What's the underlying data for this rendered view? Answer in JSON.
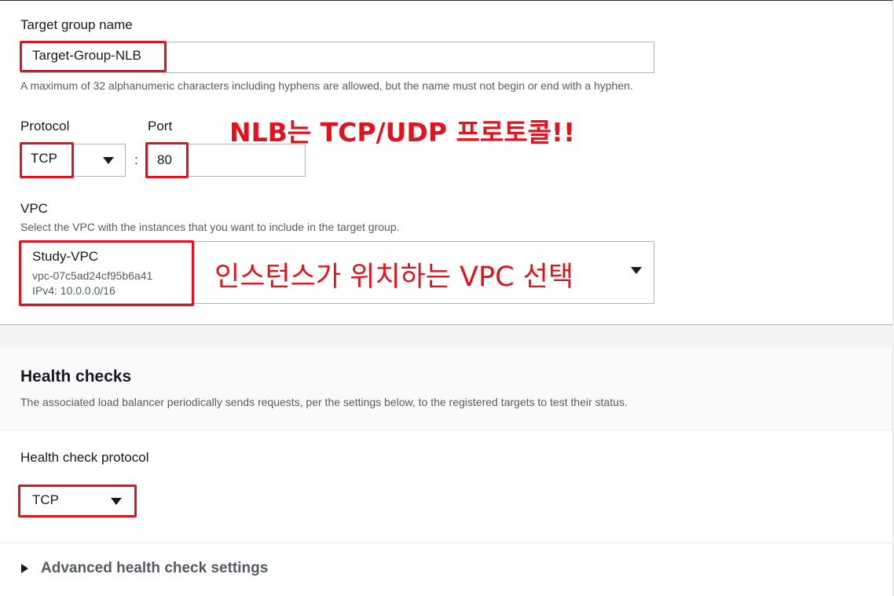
{
  "target_group": {
    "label": "Target group name",
    "value": "Target-Group-NLB",
    "hint": "A maximum of 32 alphanumeric characters including hyphens are allowed, but the name must not begin or end with a hyphen."
  },
  "protocol": {
    "label": "Protocol",
    "value": "TCP",
    "separator": ":"
  },
  "port": {
    "label": "Port",
    "value": "80"
  },
  "annotations": {
    "protocol_note": "NLB는 TCP/UDP 프로토콜!!",
    "vpc_note": "인스턴스가 위치하는 VPC 선택",
    "color": "#e0141e"
  },
  "vpc": {
    "label": "VPC",
    "hint": "Select the VPC with the instances that you want to include in the target group.",
    "name": "Study-VPC",
    "id": "vpc-07c5ad24cf95b6a41",
    "cidr": "IPv4: 10.0.0.0/16"
  },
  "health_checks": {
    "title": "Health checks",
    "description": "The associated load balancer periodically sends requests, per the settings below, to the registered targets to test their status.",
    "protocol_label": "Health check protocol",
    "protocol_value": "TCP",
    "advanced_label": "Advanced health check settings"
  }
}
